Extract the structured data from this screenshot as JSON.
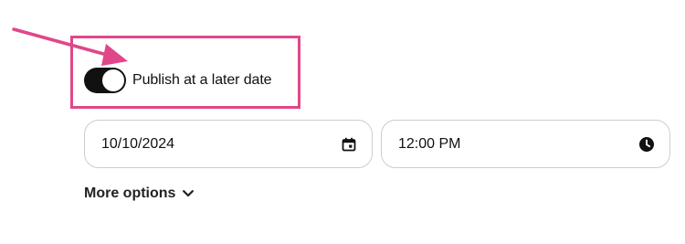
{
  "annotation": {
    "accent_color": "#e0478a"
  },
  "publish_toggle": {
    "label": "Publish at a later date",
    "checked": true,
    "icon": "toggle-switch"
  },
  "schedule": {
    "date_value": "10/10/2024",
    "date_icon": "calendar-icon",
    "time_value": "12:00 PM",
    "time_icon": "clock-icon"
  },
  "more_options": {
    "label": "More options",
    "icon": "chevron-down-icon"
  }
}
